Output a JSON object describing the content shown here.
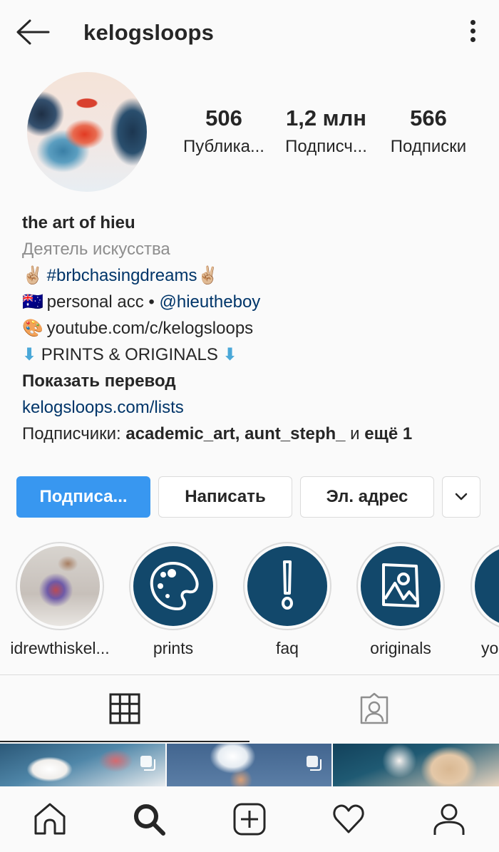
{
  "header": {
    "username": "kelogsloops",
    "back_icon": "arrow-left-icon",
    "menu_icon": "more-vertical-icon"
  },
  "profile": {
    "avatar_icon": "profile-avatar",
    "stats": [
      {
        "value": "506",
        "label": "Публика..."
      },
      {
        "value": "1,2 млн",
        "label": "Подписч..."
      },
      {
        "value": "566",
        "label": "Подписки"
      }
    ]
  },
  "bio": {
    "name": "the art of hieu",
    "category": "Деятель искусства",
    "line1": {
      "emoji_left": "✌🏼",
      "hashtag": "#brbchasingdreams",
      "emoji_right": "✌🏼"
    },
    "line2": {
      "emoji": "🇦🇺",
      "text": "personal acc • ",
      "mention": "@hieutheboy"
    },
    "line3": {
      "emoji": "🎨",
      "text": "youtube.com/c/kelogsloops"
    },
    "line4": {
      "arrow_left": "⬇",
      "text": " PRINTS & ORIGINALS ",
      "arrow_right": "⬇"
    },
    "translate": "Показать перевод",
    "website": "kelogsloops.com/lists",
    "followed_by_prefix": "Подписчики: ",
    "followed_by_names": "academic_art, aunt_steph_",
    "followed_by_and": " и ",
    "followed_by_more": "ещё 1"
  },
  "actions": {
    "follow": "Подписа...",
    "message": "Написать",
    "email": "Эл. адрес",
    "more_icon": "chevron-down-icon"
  },
  "highlights": [
    {
      "label": "idrewthiskel...",
      "icon": "photo-thumbnail"
    },
    {
      "label": "prints",
      "icon": "palette-icon"
    },
    {
      "label": "faq",
      "icon": "exclamation-icon"
    },
    {
      "label": "originals",
      "icon": "image-icon"
    },
    {
      "label": "yo",
      "icon": "unknown-icon"
    }
  ],
  "tabs": [
    {
      "name": "grid",
      "icon": "grid-icon",
      "active": true
    },
    {
      "name": "tagged",
      "icon": "tagged-user-icon",
      "active": false
    }
  ],
  "posts": [
    {
      "multi": true
    },
    {
      "multi": true
    },
    {
      "multi": false
    }
  ],
  "bottom_nav": [
    {
      "name": "home",
      "icon": "home-icon"
    },
    {
      "name": "search",
      "icon": "search-icon",
      "active": true
    },
    {
      "name": "new-post",
      "icon": "plus-square-icon"
    },
    {
      "name": "activity",
      "icon": "heart-icon"
    },
    {
      "name": "profile",
      "icon": "user-icon"
    }
  ],
  "colors": {
    "primary": "#3897f0",
    "link": "#003569",
    "highlight_bg": "#12486b",
    "text": "#262626",
    "muted": "#8e8e8e"
  }
}
